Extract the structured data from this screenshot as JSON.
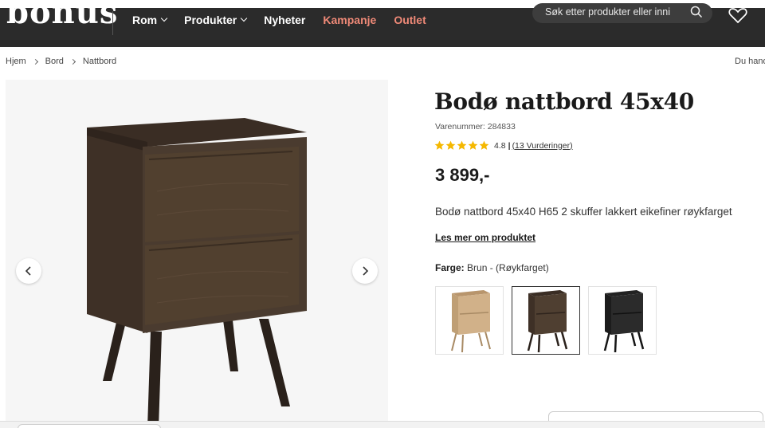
{
  "header": {
    "logo": "bonus",
    "nav": [
      {
        "label": "Rom",
        "has_dropdown": true
      },
      {
        "label": "Produkter",
        "has_dropdown": true
      },
      {
        "label": "Nyheter",
        "has_dropdown": false
      },
      {
        "label": "Kampanje",
        "has_dropdown": false
      },
      {
        "label": "Outlet",
        "has_dropdown": false
      }
    ],
    "search_placeholder": "Søk etter produkter eller inni",
    "icons": {
      "search": "search-icon",
      "wishlist": "heart-icon"
    }
  },
  "breadcrumb": [
    "Hjem",
    "Bord",
    "Nattbord"
  ],
  "breadcrumb_right": "Du hand",
  "product": {
    "title": "Bodø nattbord 45x40",
    "item_number": "Varenummer: 284833",
    "rating": {
      "value": "4.8",
      "count_text": "(13 Vurderinger)",
      "stars": 5
    },
    "price": "3 899,-",
    "description": "Bodø nattbord 45x40 H65 2 skuffer lakkert eikefiner røykfarget",
    "read_more": "Les mer om produktet",
    "color_label": "Farge:",
    "color_value": "Brun - (Røykfarget)",
    "variants": [
      {
        "name": "oak",
        "color": "#c9a77c",
        "selected": false
      },
      {
        "name": "smoked",
        "color": "#4a3b2f",
        "selected": true
      },
      {
        "name": "black",
        "color": "#1f1f1f",
        "selected": false
      }
    ]
  },
  "gallery": {
    "prev_icon": "chevron-left-icon",
    "next_icon": "chevron-right-icon"
  },
  "colors": {
    "header_bg": "#2b2b2b",
    "accent": "#f08a78",
    "star": "#f5b800"
  }
}
